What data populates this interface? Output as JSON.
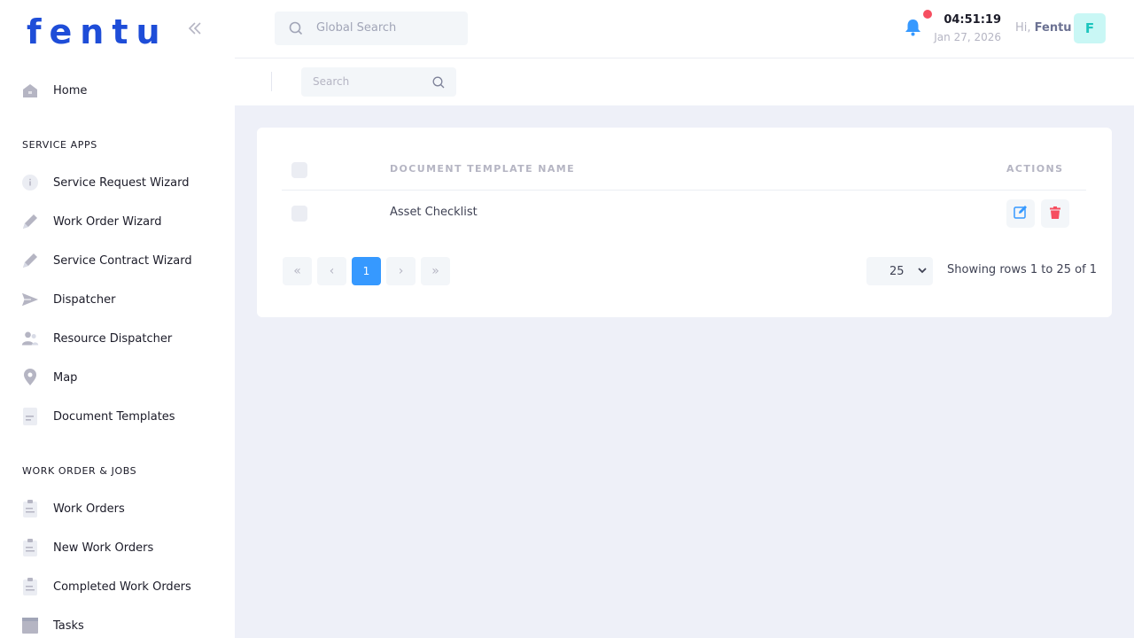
{
  "brand": {
    "logo_text": "fentu",
    "primary_color": "#1e4dd8",
    "accent_color": "#3699ff"
  },
  "sidebar": {
    "collapse_icon": "double-chevron-left-icon",
    "home": {
      "label": "Home",
      "icon": "home-icon"
    },
    "section_service": "SERVICE APPS",
    "service_items": [
      {
        "label": "Service Request Wizard",
        "icon": "info-icon"
      },
      {
        "label": "Work Order Wizard",
        "icon": "pencil-icon"
      },
      {
        "label": "Service Contract Wizard",
        "icon": "pencil-icon"
      },
      {
        "label": "Dispatcher",
        "icon": "send-icon"
      },
      {
        "label": "Resource Dispatcher",
        "icon": "users-icon"
      },
      {
        "label": "Map",
        "icon": "map-pin-icon"
      },
      {
        "label": "Document Templates",
        "icon": "document-icon"
      }
    ],
    "section_work": "WORK ORDER & JOBS",
    "work_items": [
      {
        "label": "Work Orders",
        "icon": "clipboard-icon"
      },
      {
        "label": "New Work Orders",
        "icon": "clipboard-icon"
      },
      {
        "label": "Completed Work Orders",
        "icon": "clipboard-icon"
      },
      {
        "label": "Tasks",
        "icon": "box-icon"
      }
    ]
  },
  "header": {
    "global_search_placeholder": "Global Search",
    "time": "04:51:19",
    "date": "Jan 27, 2026",
    "greeting": "Hi,",
    "user_name": "Fentu",
    "avatar_letter": "F",
    "notification_dot_color": "#f64e60"
  },
  "subheader": {
    "search_placeholder": "Search"
  },
  "table": {
    "columns": {
      "name": "DOCUMENT TEMPLATE NAME",
      "actions": "ACTIONS"
    },
    "rows": [
      {
        "name": "Asset Checklist"
      }
    ]
  },
  "pagination": {
    "first": "«",
    "prev": "‹",
    "current": "1",
    "next": "›",
    "last": "»",
    "rows_per_page": "25",
    "showing": "Showing rows 1 to 25 of 1"
  }
}
